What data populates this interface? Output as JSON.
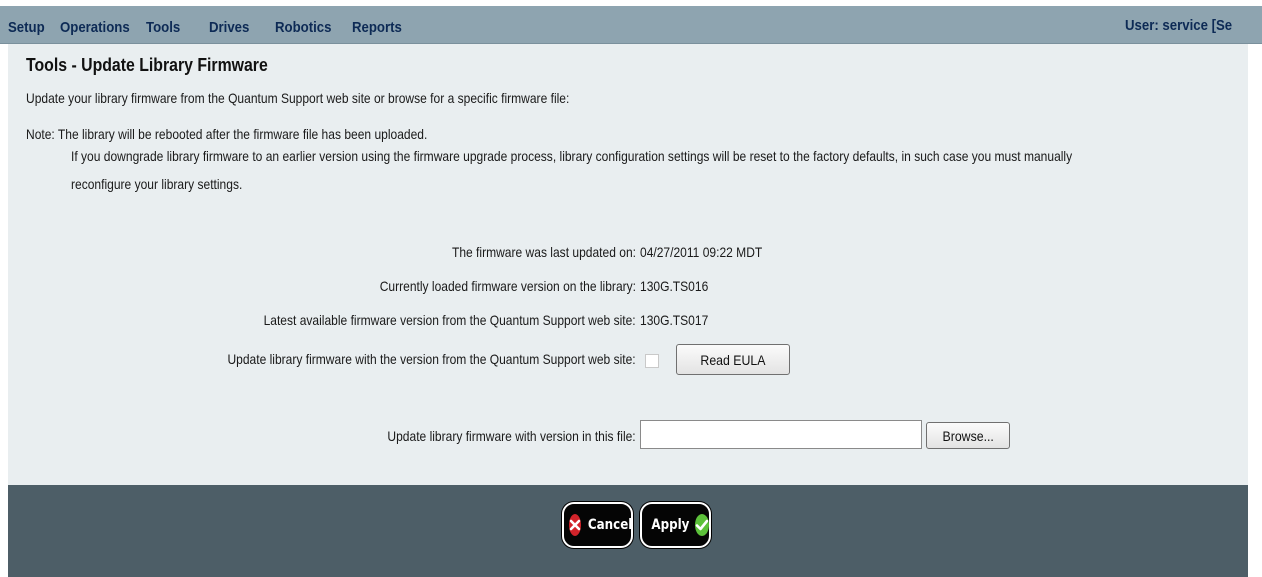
{
  "menu": {
    "items": [
      "Setup",
      "Operations",
      "Tools",
      "Drives",
      "Robotics",
      "Reports"
    ],
    "user": "User: service [Se"
  },
  "page": {
    "title": "Tools - Update Library Firmware",
    "intro": "Update your library firmware from the Quantum Support web site or browse for a specific firmware file:",
    "note_line1": "Note: The library will be rebooted after the firmware file has been uploaded.",
    "note_line2": "If you downgrade library firmware to an earlier version using the firmware upgrade process, library configuration settings will be reset to the factory defaults, in such case you must manually",
    "note_line3": "reconfigure your library settings."
  },
  "info": {
    "last_updated_label": "The firmware was last updated on:",
    "last_updated_value": "04/27/2011 09:22 MDT",
    "current_label": "Currently loaded firmware version on the library:",
    "current_value": "130G.TS016",
    "latest_label": "Latest available firmware version from the Quantum Support web site:",
    "latest_value": "130G.TS017",
    "update_web_label": "Update library firmware with the version from the Quantum Support web site:",
    "update_web_checked": false,
    "read_eula_label": "Read EULA",
    "update_file_label": "Update library firmware with version in this file:",
    "file_value": "",
    "browse_label": "Browse..."
  },
  "footer": {
    "cancel_label": "Cancel",
    "apply_label": "Apply",
    "cancel_icon": "x-circle-icon",
    "apply_icon": "check-circle-icon"
  },
  "colors": {
    "menubar": "#8ea4b0",
    "menu_text": "#0d2a55",
    "content_bg": "#e9eef0",
    "footer_bg": "#4d5e67",
    "cancel_red": "#d2232a",
    "apply_green": "#5cc13a"
  }
}
